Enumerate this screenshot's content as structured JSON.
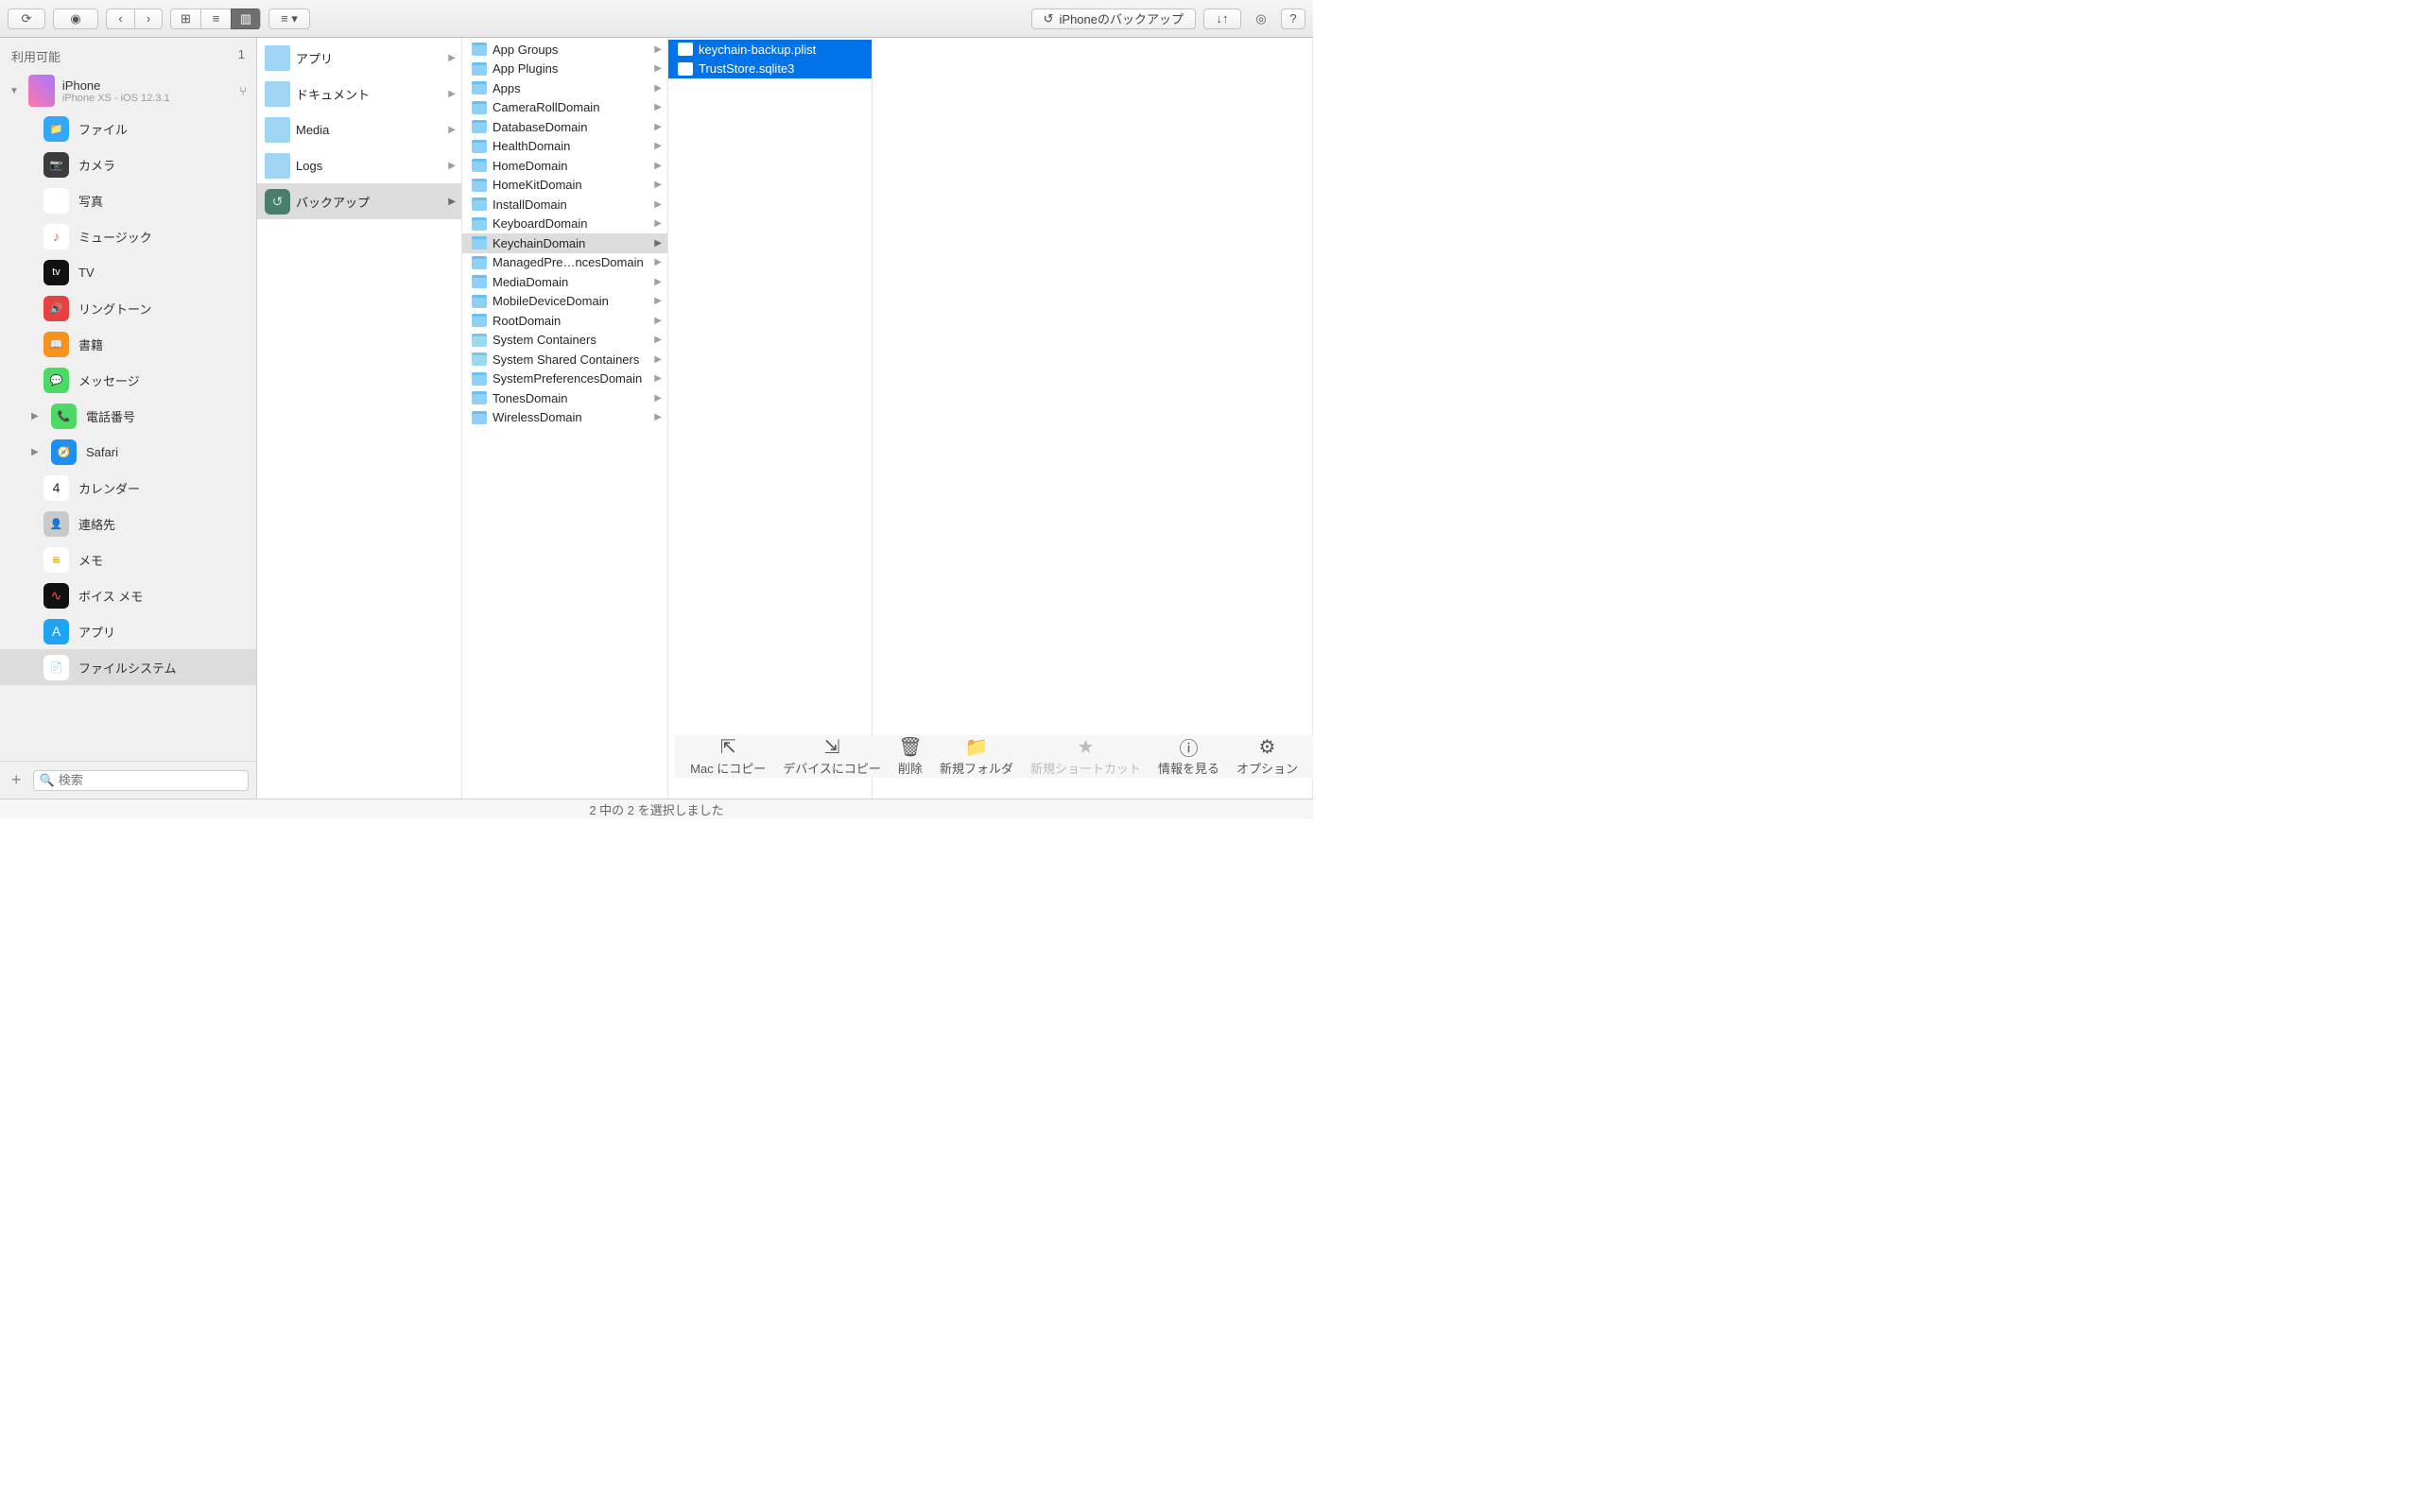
{
  "toolbar": {
    "path_label": "iPhoneのバックアップ"
  },
  "sidebar": {
    "section": "利用可能",
    "count": "1",
    "device": {
      "name": "iPhone",
      "sub": "iPhone XS - iOS 12.3.1"
    },
    "items": [
      {
        "label": "ファイル",
        "color": "#35a7f7",
        "glyph": "📁"
      },
      {
        "label": "カメラ",
        "color": "#3c3c3c",
        "glyph": "📷"
      },
      {
        "label": "写真",
        "color": "#fff",
        "glyph": "🏞"
      },
      {
        "label": "ミュージック",
        "color": "#fff",
        "glyph": "♪",
        "fg": "#f55"
      },
      {
        "label": "TV",
        "color": "#111",
        "glyph": "tv",
        "fg": "#fff"
      },
      {
        "label": "リングトーン",
        "color": "#e64040",
        "glyph": "🔊"
      },
      {
        "label": "書籍",
        "color": "#f6921e",
        "glyph": "📖"
      },
      {
        "label": "メッセージ",
        "color": "#4cd964",
        "glyph": "💬"
      },
      {
        "label": "電話番号",
        "color": "#4cd964",
        "glyph": "📞",
        "expand": true
      },
      {
        "label": "Safari",
        "color": "#1f8ef1",
        "glyph": "🧭",
        "expand": true
      },
      {
        "label": "カレンダー",
        "color": "#fff",
        "glyph": "4",
        "fg": "#222"
      },
      {
        "label": "連絡先",
        "color": "#c9c9c9",
        "glyph": "👤"
      },
      {
        "label": "メモ",
        "color": "#fff",
        "glyph": "≡",
        "fg": "#c90"
      },
      {
        "label": "ボイス メモ",
        "color": "#111",
        "glyph": "∿",
        "fg": "#f55"
      },
      {
        "label": "アプリ",
        "color": "#1ea4f2",
        "glyph": "A"
      },
      {
        "label": "ファイルシステム",
        "color": "#fff",
        "glyph": "📄",
        "selected": true
      }
    ]
  },
  "search_placeholder": "検索",
  "col1": [
    {
      "label": "アプリ",
      "type": "cat",
      "color": "#9fd4f5"
    },
    {
      "label": "ドキュメント",
      "type": "cat",
      "color": "#9fd4f5"
    },
    {
      "label": "Media",
      "type": "cat",
      "color": "#9fd4f5"
    },
    {
      "label": "Logs",
      "type": "cat",
      "color": "#9fd4f5"
    },
    {
      "label": "バックアップ",
      "type": "tm",
      "selected": true
    }
  ],
  "col2": [
    {
      "label": "App Groups",
      "t": "folder"
    },
    {
      "label": "App Plugins",
      "t": "folder"
    },
    {
      "label": "Apps",
      "t": "folder"
    },
    {
      "label": "CameraRollDomain",
      "t": "folder"
    },
    {
      "label": "DatabaseDomain",
      "t": "folder"
    },
    {
      "label": "HealthDomain",
      "t": "folder"
    },
    {
      "label": "HomeDomain",
      "t": "folder"
    },
    {
      "label": "HomeKitDomain",
      "t": "folder"
    },
    {
      "label": "InstallDomain",
      "t": "folder"
    },
    {
      "label": "KeyboardDomain",
      "t": "folder"
    },
    {
      "label": "KeychainDomain",
      "t": "folder",
      "selected": true
    },
    {
      "label": "ManagedPre…ncesDomain",
      "t": "folder"
    },
    {
      "label": "MediaDomain",
      "t": "folder"
    },
    {
      "label": "MobileDeviceDomain",
      "t": "folder"
    },
    {
      "label": "RootDomain",
      "t": "folder"
    },
    {
      "label": "System Containers",
      "t": "appcont"
    },
    {
      "label": "System Shared Containers",
      "t": "appcont"
    },
    {
      "label": "SystemPreferencesDomain",
      "t": "folder"
    },
    {
      "label": "TonesDomain",
      "t": "folder"
    },
    {
      "label": "WirelessDomain",
      "t": "folder"
    }
  ],
  "col3": [
    {
      "label": "keychain-backup.plist",
      "t": "file",
      "selected": true
    },
    {
      "label": "TrustStore.sqlite3",
      "t": "file",
      "selected": true
    }
  ],
  "actions": [
    {
      "label": "Mac にコピー",
      "icon": "⇱"
    },
    {
      "label": "デバイスにコピー",
      "icon": "⇲"
    },
    {
      "label": "削除",
      "icon": "🗑"
    },
    {
      "label": "新規フォルダ",
      "icon": "📁"
    },
    {
      "label": "新規ショートカット",
      "icon": "★",
      "disabled": true
    },
    {
      "label": "情報を見る",
      "icon": "ⓘ"
    },
    {
      "label": "オプション",
      "icon": "⚙"
    }
  ],
  "status": "2 中の 2 を選択しました"
}
